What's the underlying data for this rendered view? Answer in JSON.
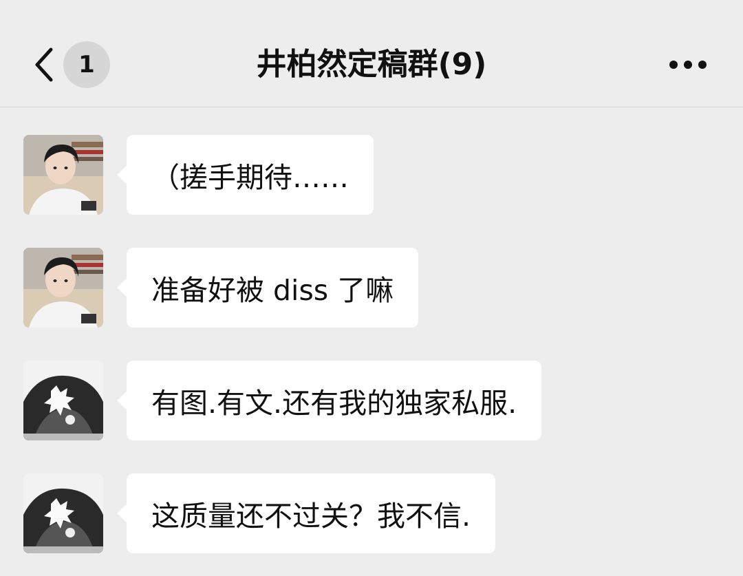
{
  "header": {
    "unread_count": "1",
    "title": "井柏然定稿群(9)"
  },
  "messages": [
    {
      "text": "（搓手期待……",
      "avatar": "avatar-white-shirt-photo"
    },
    {
      "text": "准备好被 diss 了嘛",
      "avatar": "avatar-white-shirt-photo"
    },
    {
      "text": "有图.有文.还有我的独家私服.",
      "avatar": "avatar-bw-sketch-photo"
    },
    {
      "text": "这质量还不过关？我不信.",
      "avatar": "avatar-bw-sketch-photo"
    }
  ],
  "colors": {
    "background": "#ededed",
    "bubble": "#ffffff",
    "text": "#111111",
    "badge": "#d6d6d6"
  }
}
